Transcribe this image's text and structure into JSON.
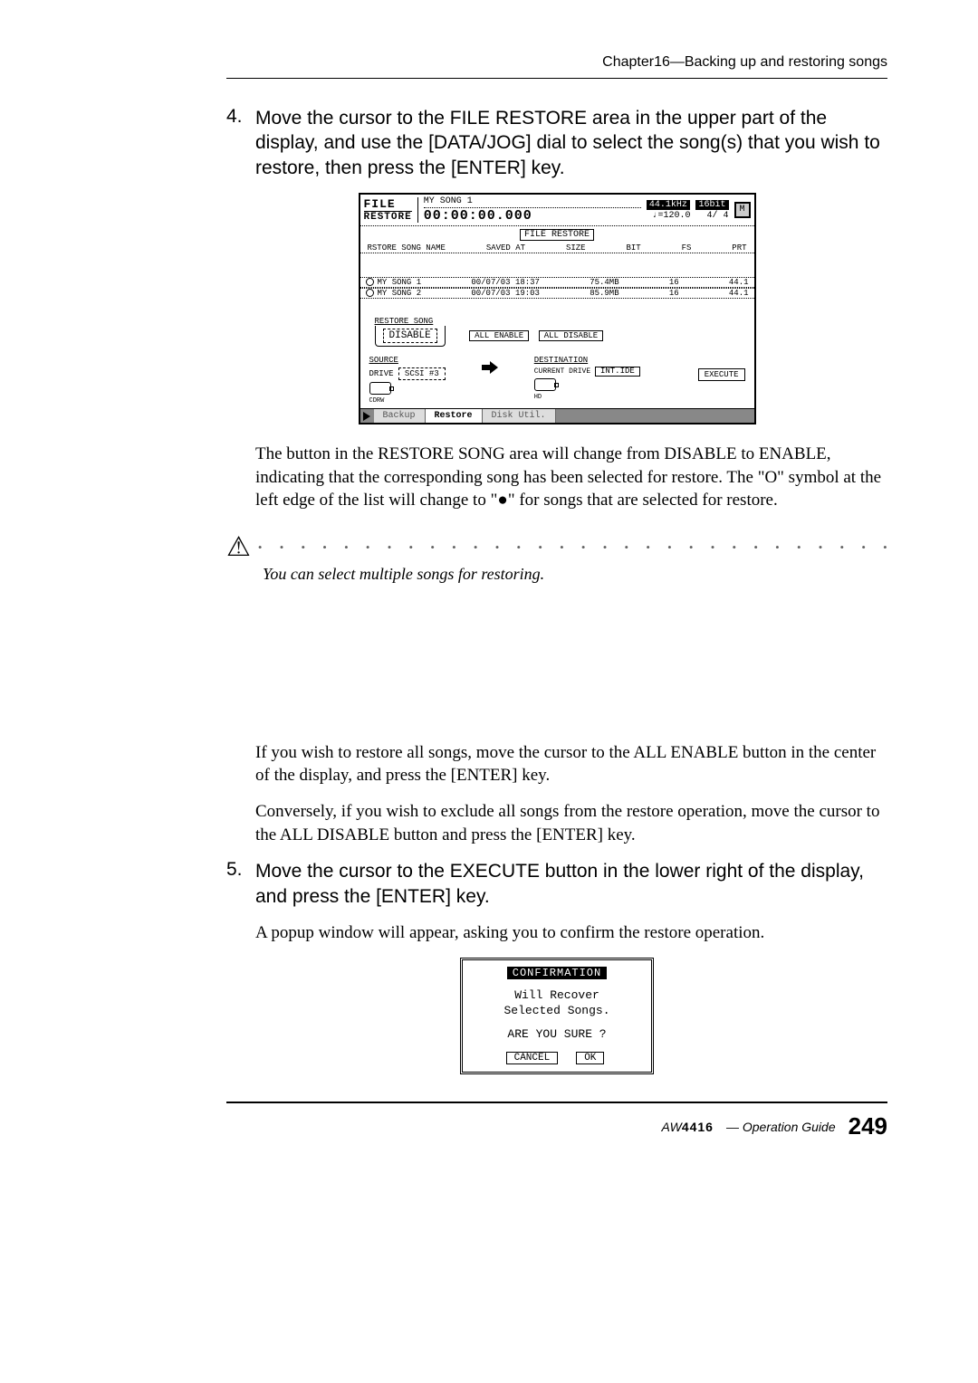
{
  "header": {
    "chapter": "Chapter16—Backing up and restoring songs"
  },
  "step4": {
    "num": "4.",
    "text": "Move the cursor to the FILE RESTORE area in the upper part of the display, and use the [DATA/JOG] dial to select the song(s) that you wish to restore, then press the [ENTER] key."
  },
  "lcd": {
    "title_line1": "FILE",
    "title_line2": "RESTORE",
    "songname": "MY SONG 1",
    "timecode": "00:00:00.000",
    "khz": "44.1kHz",
    "bit": "16bit",
    "tempo": "♩=120.0",
    "sig": "4/ 4",
    "m": "M",
    "section": "FILE RESTORE",
    "columns": [
      "RSTORE SONG NAME",
      "SAVED AT",
      "SIZE",
      "BIT",
      "FS",
      "PRT"
    ],
    "rows": [
      {
        "mark": "○",
        "name": "MY SONG 1",
        "saved": "00/07/03 18:37",
        "size": "75.4MB",
        "bit": "16",
        "fs": "44.1"
      },
      {
        "mark": "○",
        "name": "MY SONG 2",
        "saved": "00/07/03 19:03",
        "size": "85.9MB",
        "bit": "16",
        "fs": "44.1"
      }
    ],
    "restore_song_label": "RESTORE SONG",
    "btn_disable": "DISABLE",
    "btn_all_enable": "ALL ENABLE",
    "btn_all_disable": "ALL DISABLE",
    "source_label": "SOURCE",
    "drive_label": "DRIVE",
    "drive_value": "SCSI #3",
    "drive_icon_label": "CDRW",
    "destination_label": "DESTINATION",
    "current_drive": "CURRENT DRIVE",
    "dest_drive": "INT.IDE",
    "dest_icon_label": "HD",
    "execute": "EXECUTE",
    "tabs": [
      "Backup",
      "Restore",
      "Disk Util."
    ]
  },
  "para1": "The button in the RESTORE SONG area will change from DISABLE to ENABLE, indicating that the corresponding song has been selected for restore. The \"O\" symbol at the left edge of the list will change to \"●\" for songs that are selected for restore.",
  "note1": "You can select multiple songs for restoring.",
  "para2": "If you wish to restore all songs, move the cursor to the ALL ENABLE button in the center of the display, and press the [ENTER] key.",
  "para3": "Conversely, if you wish to exclude all songs from the restore operation, move the cursor to the ALL DISABLE button and press the [ENTER] key.",
  "step5": {
    "num": "5.",
    "text": "Move the cursor to the EXECUTE button in the lower right of the display, and press the [ENTER] key."
  },
  "para4": "A popup window will appear, asking you to confirm the restore operation.",
  "popup": {
    "title": "CONFIRMATION",
    "line1": "Will Recover",
    "line2": "Selected Songs.",
    "line3": "ARE YOU SURE ?",
    "cancel": "CANCEL",
    "ok": "OK"
  },
  "footer": {
    "brand_prefix": "AW",
    "brand_model": "4416",
    "label": "— Operation Guide",
    "page": "249"
  }
}
